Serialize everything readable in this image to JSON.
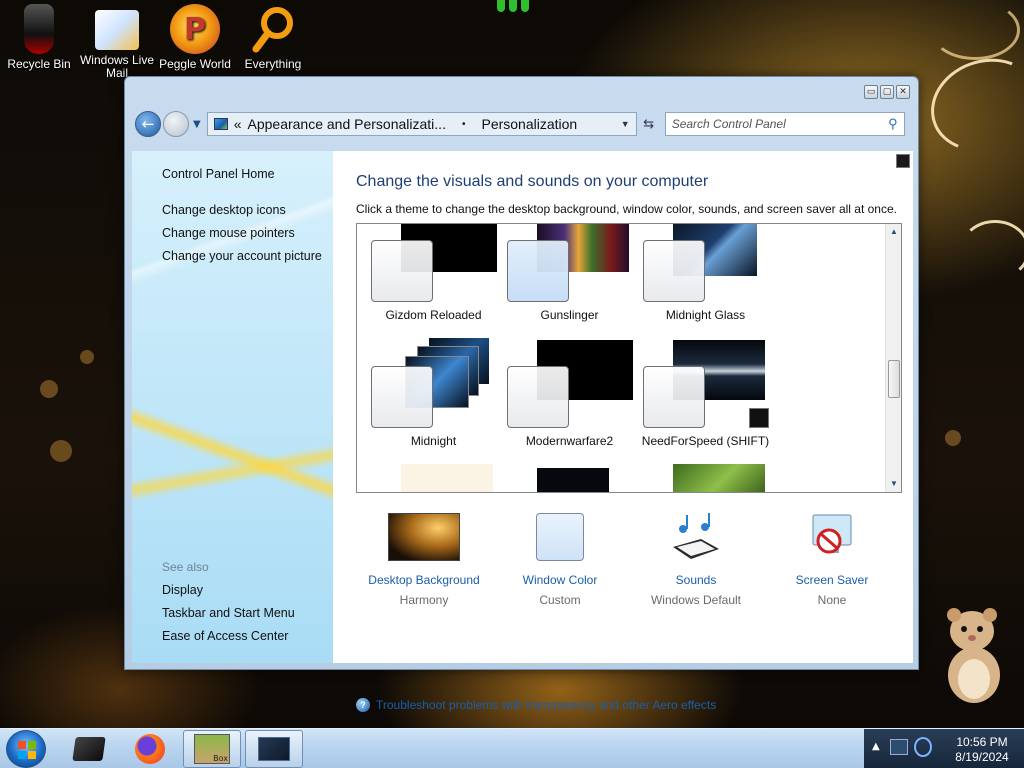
{
  "desktop": {
    "icons": [
      {
        "label": "Recycle Bin",
        "icon": "recycle-bin-icon"
      },
      {
        "label": "Windows Live Mail",
        "icon": "mail-icon"
      },
      {
        "label": "Peggle World",
        "icon": "peggle-icon"
      },
      {
        "label": "Everything",
        "icon": "magnifier-icon"
      }
    ]
  },
  "window": {
    "breadcrumb_prefix": "«",
    "breadcrumb_parent": "Appearance and Personalizati...",
    "breadcrumb_separator": "•",
    "breadcrumb_current": "Personalization",
    "search_placeholder": "Search Control Panel",
    "controls": {
      "minimize": "▭",
      "maximize": "▢",
      "close": "✕"
    }
  },
  "left_pane": {
    "home": "Control Panel Home",
    "links": [
      "Change desktop icons",
      "Change mouse pointers",
      "Change your account picture"
    ],
    "see_also_label": "See also",
    "see_also": [
      "Display",
      "Taskbar and Start Menu",
      "Ease of Access Center"
    ]
  },
  "content": {
    "heading": "Change the visuals and sounds on your computer",
    "subtext": "Click a theme to change the desktop background, window color, sounds, and screen saver all at once.",
    "themes": [
      {
        "name": "Gizdom Reloaded"
      },
      {
        "name": "Gunslinger"
      },
      {
        "name": "Midnight Glass"
      },
      {
        "name": "Midnight"
      },
      {
        "name": "Modernwarfare2"
      },
      {
        "name": "NeedForSpeed (SHIFT)"
      }
    ],
    "settings": [
      {
        "label": "Desktop Background",
        "value": "Harmony",
        "icon": "desktop-background-thumb"
      },
      {
        "label": "Window Color",
        "value": "Custom",
        "icon": "window-color-swatch"
      },
      {
        "label": "Sounds",
        "value": "Windows Default",
        "icon": "sounds-icon"
      },
      {
        "label": "Screen Saver",
        "value": "None",
        "icon": "screen-saver-icon"
      }
    ],
    "troubleshoot": "Troubleshoot problems with transparency and other Aero effects"
  },
  "taskbar": {
    "time": "10:56 PM",
    "date": "8/19/2024",
    "tray_arrow": "▲",
    "box_label": "Box"
  },
  "colors": {
    "link": "#1a5eac",
    "heading": "#1e3f75",
    "taskbar": "#b7d3ee"
  }
}
